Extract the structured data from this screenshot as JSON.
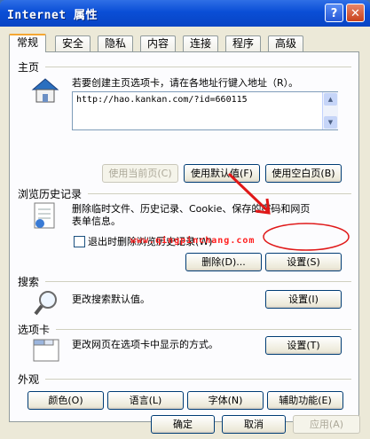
{
  "window": {
    "title": "Internet 属性",
    "help_glyph": "?",
    "close_glyph": "✕"
  },
  "tabs": [
    "常规",
    "安全",
    "隐私",
    "内容",
    "连接",
    "程序",
    "高级"
  ],
  "home": {
    "label": "主页",
    "hint": "若要创建主页选项卡，请在各地址行键入地址（R）。",
    "url": "http://hao.kankan.com/?id=660115",
    "btn_current": "使用当前页(C)",
    "btn_default": "使用默认值(F)",
    "btn_blank": "使用空白页(B)"
  },
  "history": {
    "label": "浏览历史记录",
    "text_line1": "删除临时文件、历史记录、Cookie、保存的密码和网页",
    "text_line2": "表单信息。",
    "checkbox_label": "退出时删除浏览历史记录(W)",
    "btn_delete": "删除(D)...",
    "btn_settings": "设置(S)"
  },
  "watermark": "www.qingpinchang.com",
  "search": {
    "label": "搜索",
    "text": "更改搜索默认值。",
    "btn_settings": "设置(I)"
  },
  "tabsec": {
    "label": "选项卡",
    "text": "更改网页在选项卡中显示的方式。",
    "btn_settings": "设置(T)"
  },
  "appearance": {
    "label": "外观",
    "btn_colors": "颜色(O)",
    "btn_languages": "语言(L)",
    "btn_fonts": "字体(N)",
    "btn_accessibility": "辅助功能(E)"
  },
  "footer": {
    "btn_ok": "确定",
    "btn_cancel": "取消",
    "btn_apply": "应用(A)"
  },
  "colors": {
    "annotation_red": "#e01818",
    "titlebar_blue": "#0a4ed6"
  }
}
